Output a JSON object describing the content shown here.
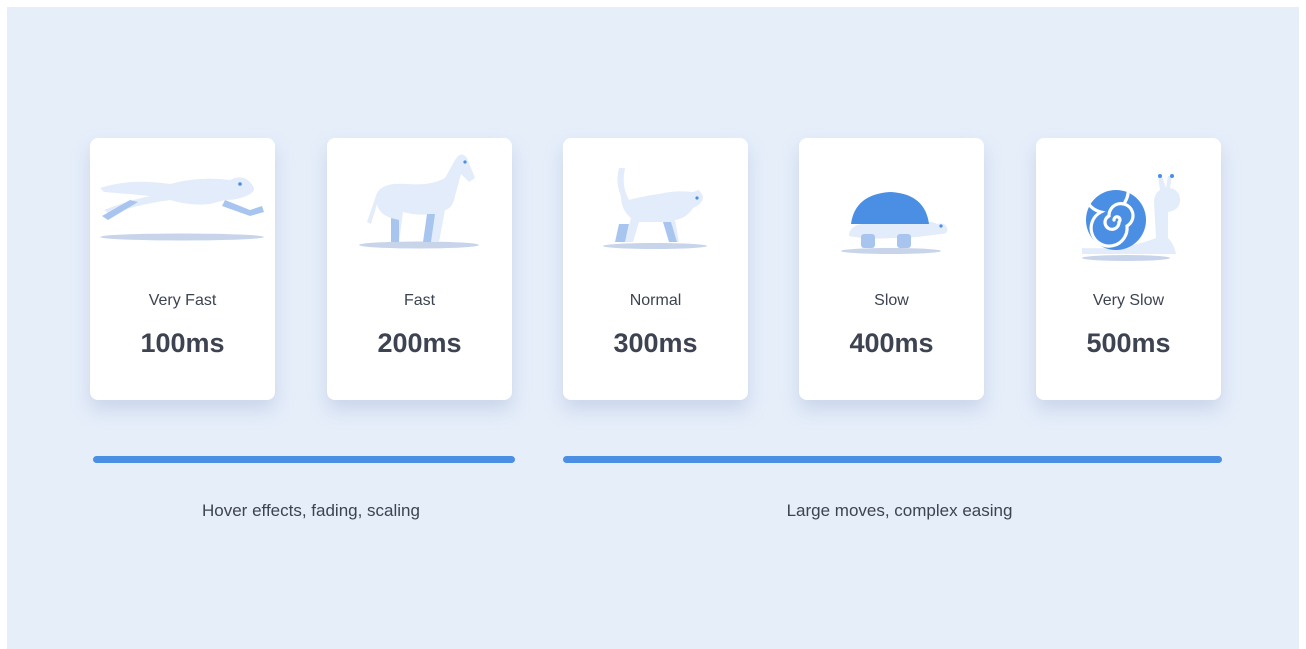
{
  "speeds": [
    {
      "label": "Very Fast",
      "value": "100ms",
      "animal": "cheetah-icon"
    },
    {
      "label": "Fast",
      "value": "200ms",
      "animal": "horse-icon"
    },
    {
      "label": "Normal",
      "value": "300ms",
      "animal": "cat-icon"
    },
    {
      "label": "Slow",
      "value": "400ms",
      "animal": "turtle-icon"
    },
    {
      "label": "Very Slow",
      "value": "500ms",
      "animal": "snail-icon"
    }
  ],
  "ranges": [
    {
      "text": "Hover effects, fading, scaling"
    },
    {
      "text": "Large moves, complex easing"
    }
  ],
  "colors": {
    "background": "#e6eefa",
    "accent": "#4a8fe4",
    "animal_body": "#e3ecfa",
    "animal_shade": "#a8c5ef",
    "text": "#3d4350"
  }
}
